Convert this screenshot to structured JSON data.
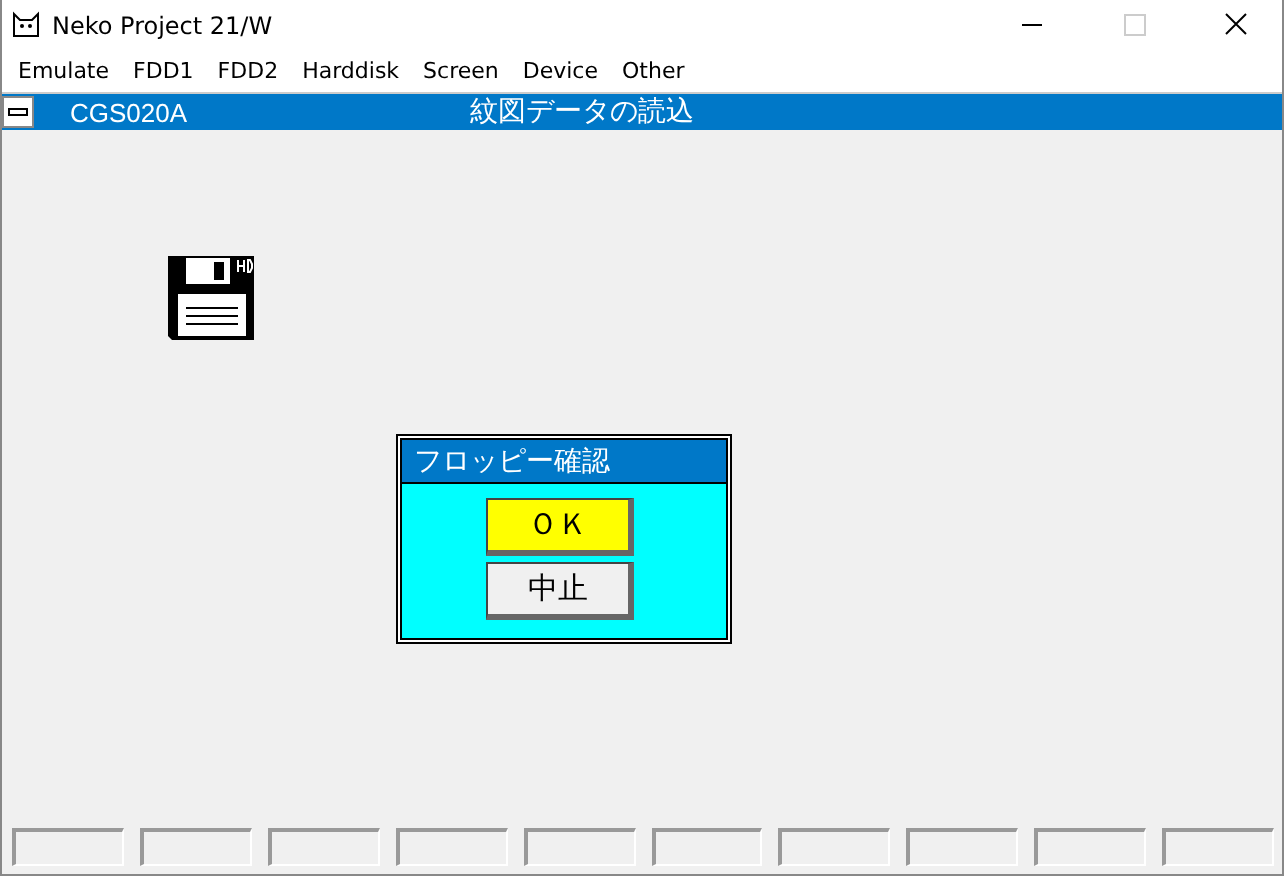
{
  "window": {
    "title": "Neko Project 21/W"
  },
  "menu": [
    "Emulate",
    "FDD1",
    "FDD2",
    "Harddisk",
    "Screen",
    "Device",
    "Other"
  ],
  "header": {
    "program": "CGS020A",
    "title": "紋図データの読込"
  },
  "dialog": {
    "title": "フロッピー確認",
    "buttons": [
      {
        "label": "ＯＫ",
        "kind": "primary"
      },
      {
        "label": "中止",
        "kind": "cancel"
      }
    ]
  }
}
